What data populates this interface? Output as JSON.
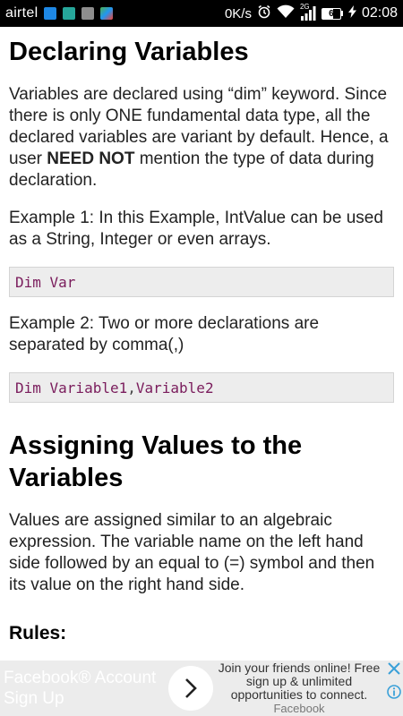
{
  "status_bar": {
    "carrier": "airtel",
    "speed": "0K/s",
    "network": "2G",
    "battery": "6",
    "time": "02:08"
  },
  "article": {
    "heading1": "Declaring Variables",
    "para1_prefix": "Variables are declared using “dim” keyword. Since there is only ONE fundamental data type, all the declared variables are variant by default. Hence, a user ",
    "para1_bold": "NEED NOT",
    "para1_suffix": " mention the type of data during declaration.",
    "example1": "Example 1: In this Example, IntValue can be used as a String, Integer or even arrays.",
    "code1": "Dim Var",
    "example2": "Example 2: Two or more declarations are separated by comma(,)",
    "code2_a": "Dim Variable1",
    "code2_sep": ",",
    "code2_b": "Variable2",
    "heading2": "Assigning Values to the Variables",
    "para2": "Values are assigned similar to an algebraic expression. The variable name on the left hand side followed by an equal to (=) symbol and then its value on the right hand side.",
    "rules_heading": "Rules:"
  },
  "ad": {
    "title": "Facebook® Account Sign Up",
    "description": "Join your friends online! Free sign up & unlimited opportunities to connect.",
    "source": "Facebook"
  },
  "colors": {
    "code_text": "#7a1c5c",
    "code_bg": "#ededed",
    "ad_bg": "#ececec",
    "adchoices": "#3aa0d8"
  }
}
